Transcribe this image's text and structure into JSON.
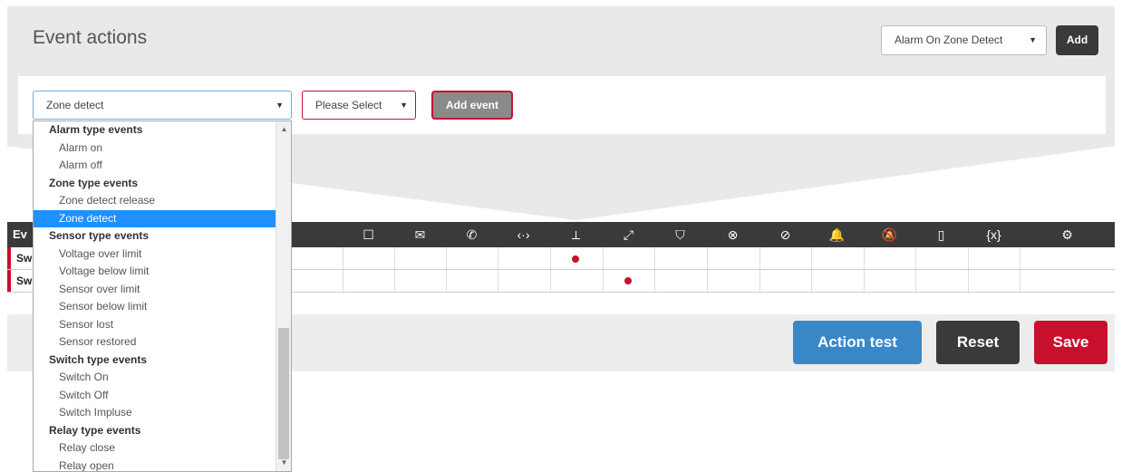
{
  "header": {
    "title": "Event actions",
    "action_select_value": "Alarm On Zone Detect",
    "add_label": "Add"
  },
  "event_form": {
    "event_select_value": "Zone detect",
    "condition_select_value": "Please Select",
    "add_event_label": "Add event"
  },
  "dropdown": {
    "items": [
      {
        "label": "Alarm type events",
        "group": true
      },
      {
        "label": "Alarm on"
      },
      {
        "label": "Alarm off"
      },
      {
        "label": "Zone type events",
        "group": true
      },
      {
        "label": "Zone detect release"
      },
      {
        "label": "Zone detect",
        "selected": true
      },
      {
        "label": "Sensor type events",
        "group": true
      },
      {
        "label": "Voltage over limit"
      },
      {
        "label": "Voltage below limit"
      },
      {
        "label": "Sensor over limit"
      },
      {
        "label": "Sensor below limit"
      },
      {
        "label": "Sensor lost"
      },
      {
        "label": "Sensor restored"
      },
      {
        "label": "Switch type events",
        "group": true
      },
      {
        "label": "Switch On"
      },
      {
        "label": "Switch Off"
      },
      {
        "label": "Switch Impluse"
      },
      {
        "label": "Relay type events",
        "group": true
      },
      {
        "label": "Relay close"
      },
      {
        "label": "Relay open"
      }
    ]
  },
  "table": {
    "first_header": "Ev",
    "column_icons": [
      "message-icon",
      "email-icon",
      "phone-icon",
      "code-icon",
      "relay-open-icon",
      "relay-close-icon",
      "shield-check-icon",
      "shield-x-icon",
      "shield-disarm-icon",
      "bell-icon",
      "bell-off-icon",
      "mobile-icon",
      "variable-icon",
      "settings-icon"
    ],
    "column_glyphs": [
      "☐",
      "✉",
      "✆",
      "‹·›",
      "⟂",
      "⤢",
      "⛉",
      "⊗",
      "⊘",
      "🔔",
      "🔕",
      "▯",
      "{x}",
      "⚙"
    ],
    "rows": [
      {
        "label": "Sw",
        "dot_column": 4
      },
      {
        "label": "Sw",
        "dot_column": 5
      }
    ]
  },
  "actions": {
    "test_label": "Action test",
    "reset_label": "Reset",
    "save_label": "Save"
  },
  "colors": {
    "accent": "#c8102e",
    "primary": "#3a87c8",
    "dark": "#3a3a3a",
    "selected": "#1e90ff"
  }
}
